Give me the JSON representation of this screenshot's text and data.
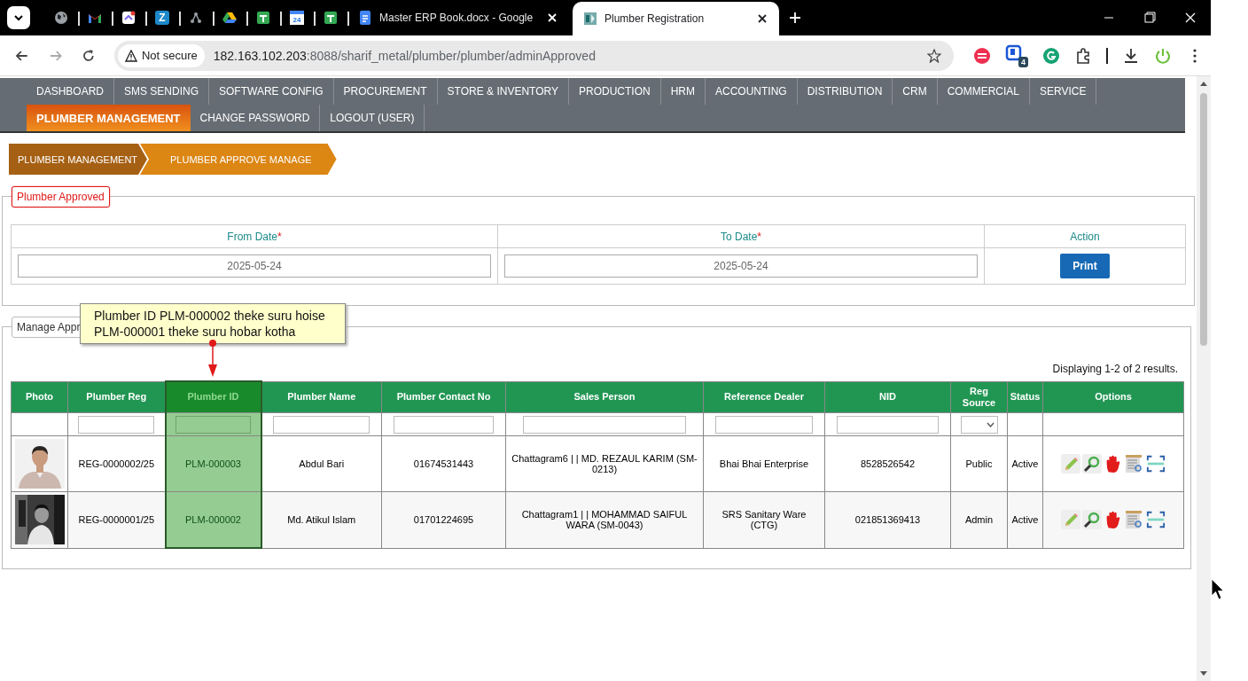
{
  "browser": {
    "tabs": [
      {
        "kind": "globe",
        "selected": false
      },
      {
        "kind": "mail",
        "selected": false
      },
      {
        "kind": "clickup",
        "selected": false
      },
      {
        "kind": "letter",
        "glyph": "Z",
        "selected": false
      },
      {
        "kind": "tree",
        "selected": false
      },
      {
        "kind": "drive",
        "selected": false
      },
      {
        "kind": "sheet",
        "selected": false
      },
      {
        "kind": "calendar",
        "glyph": "24",
        "selected": false
      },
      {
        "kind": "sheet",
        "selected": false
      },
      {
        "kind": "doc",
        "title": "Master ERP Book.docx - Google",
        "selected": false
      },
      {
        "kind": "app",
        "title": "Plumber Registration",
        "selected": true
      }
    ],
    "address": {
      "security": "Not secure",
      "host": "182.163.102.203",
      "path": ":8088/sharif_metal/plumber/plumber/adminApproved"
    },
    "extension_badge": "4"
  },
  "nav": {
    "rows": [
      {
        "items": [
          {
            "label": "DASHBOARD",
            "selected": false
          },
          {
            "label": "SMS SENDING",
            "selected": false
          },
          {
            "label": "SOFTWARE CONFIG",
            "selected": false
          },
          {
            "label": "PROCUREMENT",
            "selected": false
          },
          {
            "label": "STORE & INVENTORY",
            "selected": false
          },
          {
            "label": "PRODUCTION",
            "selected": false
          },
          {
            "label": "HRM",
            "selected": false
          },
          {
            "label": "ACCOUNTING",
            "selected": false
          },
          {
            "label": "DISTRIBUTION",
            "selected": false
          },
          {
            "label": "CRM",
            "selected": false
          },
          {
            "label": "COMMERCIAL",
            "selected": false
          },
          {
            "label": "SERVICE",
            "selected": false
          }
        ]
      },
      {
        "items": [
          {
            "label": "PLUMBER MANAGEMENT",
            "selected": true
          },
          {
            "label": "CHANGE PASSWORD",
            "selected": false
          },
          {
            "label": "LOGOUT (USER)",
            "selected": false
          }
        ]
      }
    ]
  },
  "breadcrumb": [
    "PLUMBER MANAGEMENT",
    "PLUMBER APPROVE MANAGE"
  ],
  "filter_panel": {
    "legend": "Plumber Approved",
    "fields": [
      {
        "label": "From Date",
        "required_mark": "*",
        "value": "2025-05-24"
      },
      {
        "label": "To Date",
        "required_mark": "*",
        "value": "2025-05-24"
      }
    ],
    "action": {
      "label": "Action",
      "button": "Print"
    }
  },
  "results": {
    "legend": "Manage Appr",
    "summary": "Displaying 1-2 of 2 results.",
    "columns": [
      {
        "label": "Photo",
        "highlighted": false
      },
      {
        "label": "Plumber Reg",
        "highlighted": false
      },
      {
        "label": "Plumber ID",
        "highlighted": true
      },
      {
        "label": "Plumber Name",
        "highlighted": false
      },
      {
        "label": "Plumber Contact No",
        "highlighted": false
      },
      {
        "label": "Sales Person",
        "highlighted": false
      },
      {
        "label": "Reference Dealer",
        "highlighted": false
      },
      {
        "label": "NID",
        "highlighted": false
      },
      {
        "label": "Reg Source",
        "highlighted": false
      },
      {
        "label": "Status",
        "highlighted": false
      },
      {
        "label": "Options",
        "highlighted": false
      }
    ],
    "filters": [
      {
        "kind": "none"
      },
      {
        "kind": "text"
      },
      {
        "kind": "text"
      },
      {
        "kind": "text"
      },
      {
        "kind": "text"
      },
      {
        "kind": "text"
      },
      {
        "kind": "text"
      },
      {
        "kind": "text"
      },
      {
        "kind": "select"
      },
      {
        "kind": "none"
      },
      {
        "kind": "none"
      }
    ],
    "rows": [
      {
        "photo": {
          "kind": "picture"
        },
        "cells": [
          "",
          "REG-0000002/25",
          "PLM-000003",
          "Abdul Bari",
          "01674531443",
          "Chattagram6 | | MD. REZAUL KARIM (SM-0213)",
          "Bhai Bhai Enterprise",
          "8528526542",
          "Public",
          "Active"
        ]
      },
      {
        "photo": {
          "kind": "picture"
        },
        "cells": [
          "",
          "REG-0000001/25",
          "PLM-000002",
          "Md. Atikul Islam",
          "01701224695",
          "Chattagram1 | | MOHAMMAD SAIFUL WARA (SM-0043)",
          "SRS Sanitary Ware (CTG)",
          "021851369413",
          "Admin",
          "Active"
        ]
      }
    ]
  },
  "callout": {
    "lines": [
      "Plumber ID PLM-000002 theke suru hoise",
      "PLM-000001 theke suru hobar kotha"
    ]
  }
}
